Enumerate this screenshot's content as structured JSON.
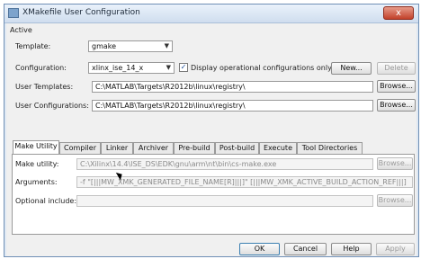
{
  "window": {
    "title": "XMakefile User Configuration",
    "close_glyph": "x"
  },
  "active_label": "Active",
  "template": {
    "label": "Template:",
    "value": "gmake"
  },
  "configuration": {
    "label": "Configuration:",
    "value": "xlinx_ise_14_x",
    "checkbox_label": "Display operational configurations only",
    "checked": true,
    "new_label": "New...",
    "delete_label": "Delete"
  },
  "user_templates": {
    "label": "User Templates:",
    "value": "C:\\MATLAB\\Targets\\R2012b\\linux\\registry\\",
    "browse_label": "Browse..."
  },
  "user_configurations": {
    "label": "User Configurations:",
    "value": "C:\\MATLAB\\Targets\\R2012b\\linux\\registry\\",
    "browse_label": "Browse..."
  },
  "tabs": [
    {
      "label": "Make Utility",
      "active": true
    },
    {
      "label": "Compiler"
    },
    {
      "label": "Linker"
    },
    {
      "label": "Archiver"
    },
    {
      "label": "Pre-build"
    },
    {
      "label": "Post-build"
    },
    {
      "label": "Execute"
    },
    {
      "label": "Tool Directories"
    }
  ],
  "make_utility": {
    "label": "Make utility:",
    "value": "C:\\Xilinx\\14.4\\ISE_DS\\EDK\\gnu\\arm\\nt\\bin\\cs-make.exe",
    "browse_label": "Browse..."
  },
  "arguments": {
    "label": "Arguments:",
    "value": "-f \"[|||MW_XMK_GENERATED_FILE_NAME[R]|||]\" [|||MW_XMK_ACTIVE_BUILD_ACTION_REF|||]"
  },
  "optional_include": {
    "label": "Optional include:",
    "value": "",
    "browse_label": "Browse..."
  },
  "footer": {
    "ok_label": "OK",
    "cancel_label": "Cancel",
    "help_label": "Help",
    "apply_label": "Apply"
  }
}
